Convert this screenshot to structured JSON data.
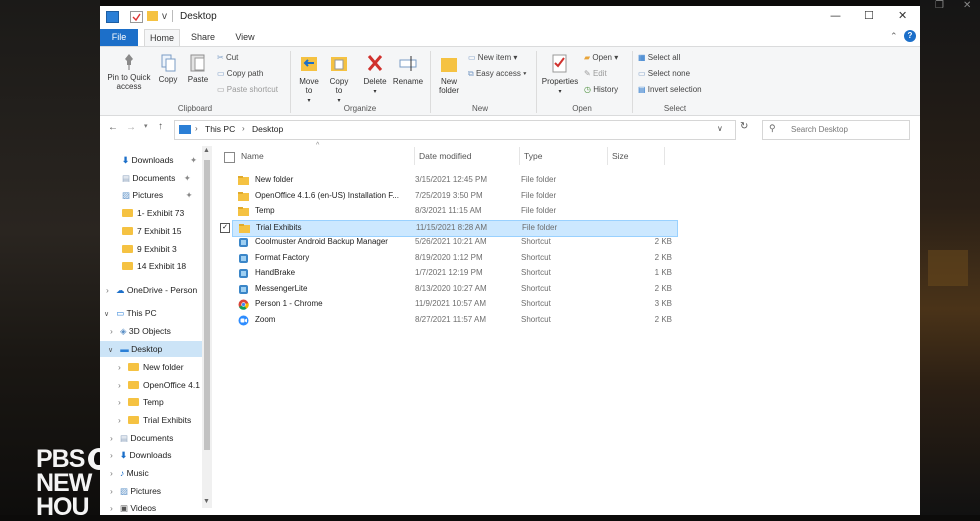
{
  "window": {
    "title": "Desktop",
    "qat_dropdown": "v"
  },
  "ribbon_tabs": [
    {
      "label": "File"
    },
    {
      "label": "Home"
    },
    {
      "label": "Share"
    },
    {
      "label": "View"
    }
  ],
  "clipboard": {
    "pin_label": "Pin to Quick access",
    "copy_label": "Copy",
    "paste_label": "Paste",
    "cut_label": "Cut",
    "copy_path_label": "Copy path",
    "paste_shortcut_label": "Paste shortcut",
    "group_label": "Clipboard"
  },
  "organize": {
    "move_to_label": "Move to",
    "copy_to_label": "Copy to",
    "delete_label": "Delete",
    "rename_label": "Rename",
    "group_label": "Organize"
  },
  "new": {
    "new_folder_label": "New folder",
    "new_item_label": "New item",
    "easy_access_label": "Easy access",
    "group_label": "New"
  },
  "open": {
    "properties_label": "Properties",
    "open_label": "Open",
    "edit_label": "Edit",
    "history_label": "History",
    "group_label": "Open"
  },
  "select": {
    "select_all_label": "Select all",
    "select_none_label": "Select none",
    "invert_label": "Invert selection",
    "group_label": "Select"
  },
  "address": {
    "segments": [
      "This PC",
      "Desktop"
    ],
    "search_placeholder": "Search Desktop"
  },
  "nav_pane": {
    "quick_access": [
      "Downloads",
      "Documents",
      "Pictures",
      "1- Exhibit 73",
      "7 Exhibit 15",
      "9 Exhibit 3",
      "14 Exhibit 18"
    ],
    "onedrive": "OneDrive - Person",
    "this_pc": "This PC",
    "objects3d": "3D Objects",
    "desktop": "Desktop",
    "desktop_children": [
      "New folder",
      "OpenOffice 4.1",
      "Temp",
      "Trial Exhibits"
    ],
    "pc_children": [
      "Documents",
      "Downloads",
      "Music",
      "Pictures",
      "Videos"
    ]
  },
  "columns": {
    "name": "Name",
    "date": "Date modified",
    "type": "Type",
    "size": "Size"
  },
  "files": [
    {
      "name": "New folder",
      "date": "3/15/2021 12:45 PM",
      "type": "File folder",
      "size": "",
      "icon": "folder"
    },
    {
      "name": "OpenOffice 4.1.6 (en-US) Installation F...",
      "date": "7/25/2019 3:50 PM",
      "type": "File folder",
      "size": "",
      "icon": "folder"
    },
    {
      "name": "Temp",
      "date": "8/3/2021 11:15 AM",
      "type": "File folder",
      "size": "",
      "icon": "folder"
    },
    {
      "name": "Trial Exhibits",
      "date": "11/15/2021 8:28 AM",
      "type": "File folder",
      "size": "",
      "icon": "folder"
    },
    {
      "name": "Coolmuster Android Backup Manager",
      "date": "5/26/2021 10:21 AM",
      "type": "Shortcut",
      "size": "2 KB",
      "icon": "app"
    },
    {
      "name": "Format Factory",
      "date": "8/19/2020 1:12 PM",
      "type": "Shortcut",
      "size": "2 KB",
      "icon": "app"
    },
    {
      "name": "HandBrake",
      "date": "1/7/2021 12:19 PM",
      "type": "Shortcut",
      "size": "1 KB",
      "icon": "app"
    },
    {
      "name": "MessengerLite",
      "date": "8/13/2020 10:27 AM",
      "type": "Shortcut",
      "size": "2 KB",
      "icon": "app"
    },
    {
      "name": "Person 1 - Chrome",
      "date": "11/9/2021 10:57 AM",
      "type": "Shortcut",
      "size": "3 KB",
      "icon": "chrome"
    },
    {
      "name": "Zoom",
      "date": "8/27/2021 11:57 AM",
      "type": "Shortcut",
      "size": "2 KB",
      "icon": "zoom"
    }
  ],
  "selected_file": "Trial Exhibits",
  "logo": {
    "line1": "PBS",
    "line2": "NEW",
    "line3": "HOU"
  },
  "colors": {
    "accent": "#1c6fc9",
    "selection": "#cce8ff",
    "folder": "#f5c242"
  }
}
